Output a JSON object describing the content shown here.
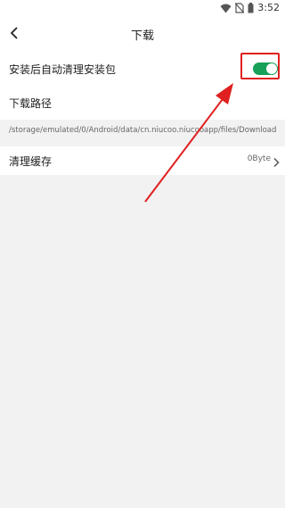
{
  "status_bar": {
    "time": "3:52",
    "icons": [
      "wifi-icon",
      "no-sim-icon",
      "battery-icon"
    ]
  },
  "header": {
    "title": "下载",
    "back_icon": "chevron-left-icon"
  },
  "settings": {
    "auto_clean": {
      "label": "安装后自动清理安装包",
      "enabled": true
    },
    "download_path": {
      "label": "下载路径",
      "value": "/storage/emulated/0/Android/data/cn.niucoo.niucooapp/files/Download"
    },
    "clear_cache": {
      "label": "清理缓存",
      "value": "0Byte"
    }
  },
  "colors": {
    "toggle_on": "#16a058",
    "annotation": "#e02020",
    "background": "#f2f2f2"
  }
}
